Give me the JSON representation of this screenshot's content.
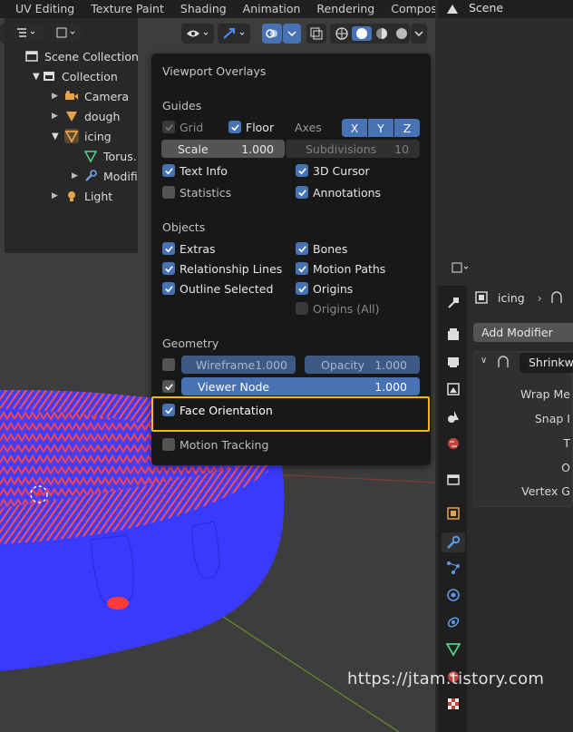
{
  "topbar": {
    "tabs": [
      "UV Editing",
      "Texture Paint",
      "Shading",
      "Animation",
      "Rendering",
      "Compositi"
    ]
  },
  "overlay": {
    "title": "Viewport Overlays",
    "guides": {
      "heading": "Guides",
      "grid": "Grid",
      "floor": "Floor",
      "axes": "Axes",
      "axis_x": "X",
      "axis_y": "Y",
      "axis_z": "Z",
      "scale_label": "Scale",
      "scale_value": "1.000",
      "subdiv_label": "Subdivisions",
      "subdiv_value": "10",
      "text_info": "Text Info",
      "cursor_3d": "3D Cursor",
      "statistics": "Statistics",
      "annotations": "Annotations"
    },
    "objects": {
      "heading": "Objects",
      "extras": "Extras",
      "bones": "Bones",
      "relationship_lines": "Relationship Lines",
      "motion_paths": "Motion Paths",
      "outline_selected": "Outline Selected",
      "origins": "Origins",
      "origins_all": "Origins (All)"
    },
    "geometry": {
      "heading": "Geometry",
      "wireframe_label": "Wireframe",
      "wireframe_value": "1.000",
      "opacity_label": "Opacity",
      "opacity_value": "1.000",
      "viewer_node_label": "Viewer Node",
      "viewer_node_value": "1.000",
      "face_orientation": "Face Orientation"
    },
    "motion_tracking": "Motion Tracking"
  },
  "outliner": {
    "scene": "Scene",
    "items": [
      "Scene Collection",
      "Collection",
      "Camera",
      "dough",
      "icing",
      "Torus.",
      "Modifi",
      "Light"
    ]
  },
  "properties": {
    "object_name": "icing",
    "add_modifier": "Add Modifier",
    "modifier_name": "Shrinkwra",
    "labels": [
      "Wrap Me",
      "Snap I",
      "T",
      "O",
      "Vertex G"
    ]
  },
  "watermark": "https://jtam.tistory.com",
  "colors": {
    "accent": "#4772b3",
    "highlight": "#f5b800",
    "panel": "#181818",
    "viewport": "#3d3d3d",
    "mesh_front": "#3d3dff",
    "mesh_back": "#ff3b3b"
  }
}
